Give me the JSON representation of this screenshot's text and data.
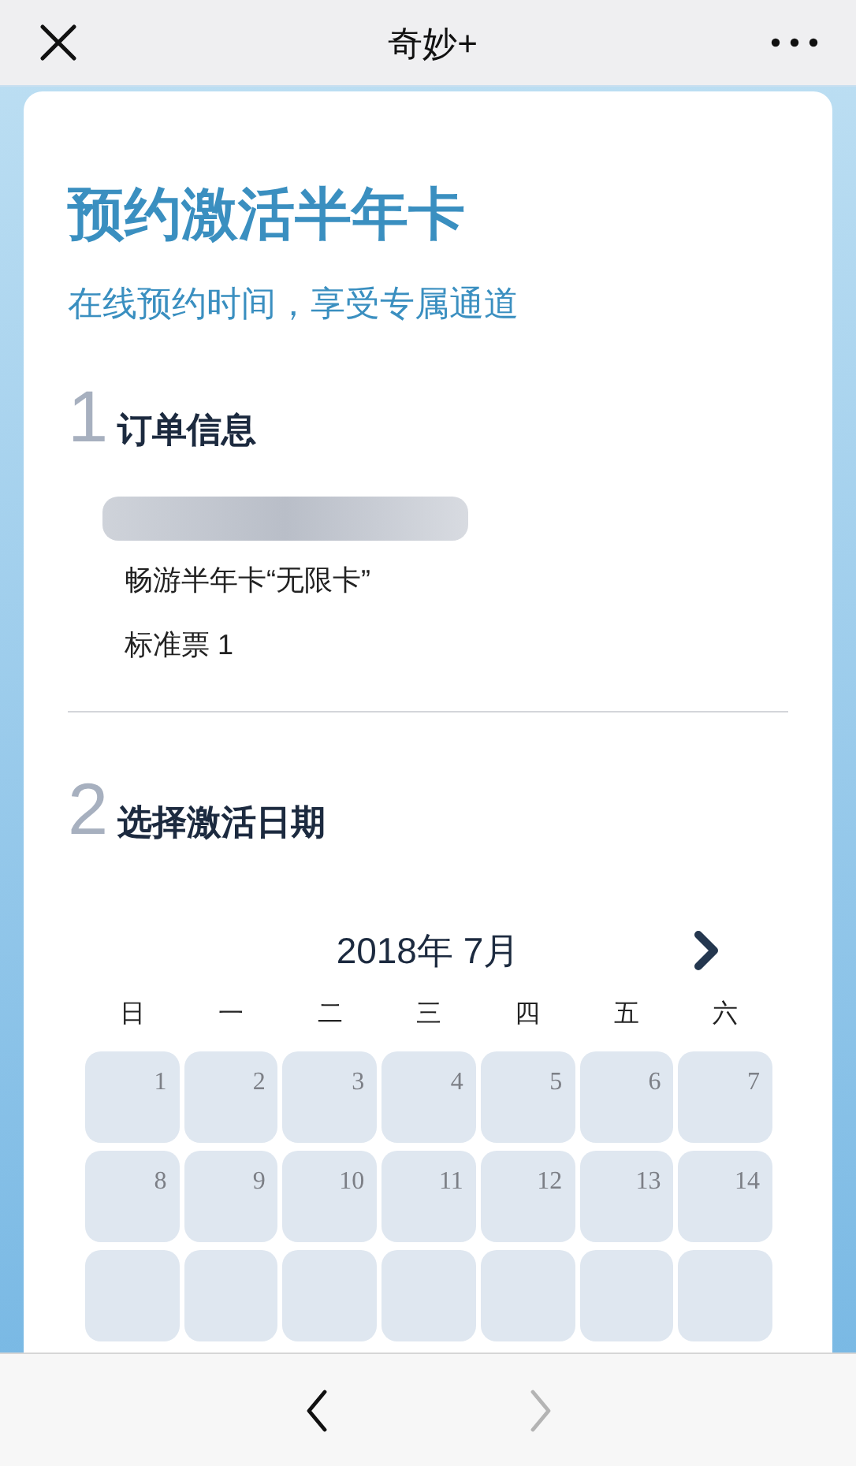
{
  "nav_bar": {
    "title": "奇妙+"
  },
  "heading": "预约激活半年卡",
  "subheading": "在线预约时间，享受专属通道",
  "sections": [
    {
      "number": "1",
      "title": "订单信息"
    },
    {
      "number": "2",
      "title": "选择激活日期"
    }
  ],
  "order": {
    "product": "畅游半年卡“无限卡”",
    "ticket": "标准票 1"
  },
  "calendar": {
    "month": "2018年 7月",
    "weekdays": [
      "日",
      "一",
      "二",
      "三",
      "四",
      "五",
      "六"
    ],
    "weeks": [
      [
        "1",
        "2",
        "3",
        "4",
        "5",
        "6",
        "7"
      ],
      [
        "8",
        "9",
        "10",
        "11",
        "12",
        "13",
        "14"
      ]
    ]
  },
  "toolbar": {
    "back": {
      "disabled": false
    },
    "forward": {
      "disabled": true
    }
  }
}
